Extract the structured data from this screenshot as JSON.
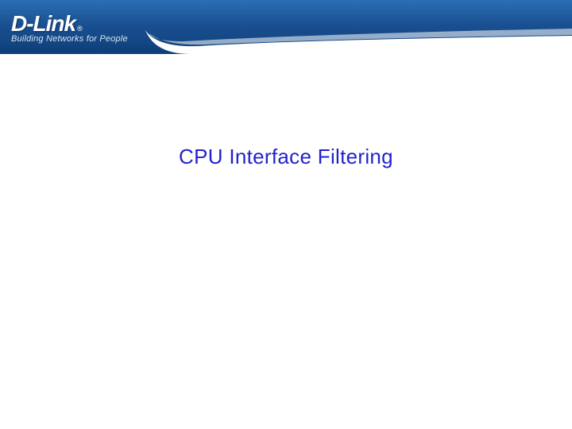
{
  "header": {
    "brand_name": "D-Link",
    "registered_mark": "®",
    "tagline": "Building Networks for People"
  },
  "slide": {
    "title": "CPU Interface Filtering"
  },
  "colors": {
    "header_gradient_top": "#2a6fb5",
    "header_gradient_bottom": "#0d3f78",
    "title_color": "#2222cc"
  }
}
